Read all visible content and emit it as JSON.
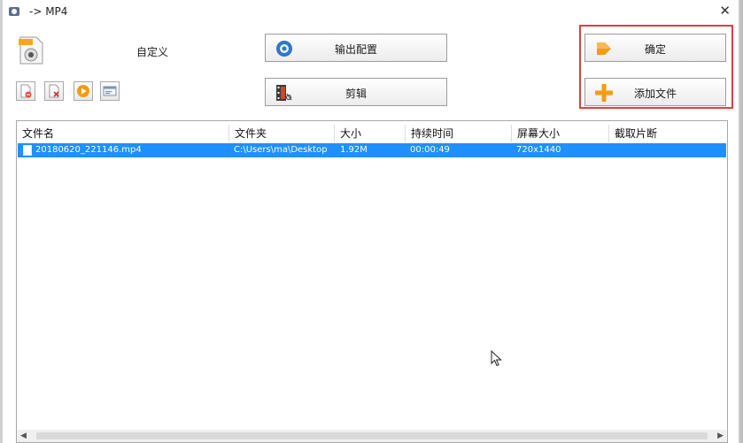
{
  "window": {
    "title": "-> MP4",
    "close_symbol": "✕"
  },
  "profile": {
    "label": "自定义",
    "icon": "mp4-file-icon"
  },
  "toolbar": {
    "buttons": [
      {
        "name": "remove-file-button",
        "icon": "file-delete-icon"
      },
      {
        "name": "clear-list-button",
        "icon": "file-clear-icon"
      },
      {
        "name": "play-button",
        "icon": "play-icon"
      },
      {
        "name": "media-info-button",
        "icon": "media-info-icon"
      }
    ]
  },
  "buttons": {
    "output_settings": "输出配置",
    "edit": "剪辑",
    "confirm": "确定",
    "add_file": "添加文件"
  },
  "list": {
    "columns": [
      "文件名",
      "文件夹",
      "大小",
      "持续时间",
      "屏幕大小",
      "截取片断"
    ],
    "rows": [
      {
        "name": "20180620_221146.mp4",
        "folder": "C:\\Users\\ma\\Desktop",
        "size": "1.92M",
        "duration": "00:00:49",
        "screen": "720x1440",
        "clip": ""
      }
    ]
  },
  "scrollbar": {
    "left": "◀",
    "right": "▶"
  },
  "colors": {
    "selection": "#1e90ff",
    "highlight": "#d9413f",
    "accent_orange": "#f39c12"
  }
}
